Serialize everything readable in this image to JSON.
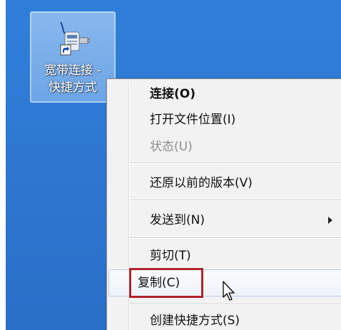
{
  "desktop": {
    "icon": {
      "name": "broadband-connection-shortcut",
      "label_line1": "宽带连接 -",
      "label_line2": "快捷方式"
    }
  },
  "context_menu": {
    "items": [
      {
        "id": "connect",
        "label": "连接(O)",
        "bold": true,
        "disabled": false
      },
      {
        "id": "open-location",
        "label": "打开文件位置(I)",
        "bold": false,
        "disabled": false
      },
      {
        "id": "status",
        "label": "状态(U)",
        "bold": false,
        "disabled": true
      },
      {
        "id": "restore-previous",
        "label": "还原以前的版本(V)",
        "bold": false,
        "disabled": false
      },
      {
        "id": "send-to",
        "label": "发送到(N)",
        "bold": false,
        "disabled": false,
        "submenu": true
      },
      {
        "id": "cut",
        "label": "剪切(T)",
        "bold": false,
        "disabled": false
      },
      {
        "id": "copy",
        "label": "复制(C)",
        "bold": false,
        "disabled": false,
        "hovered": true,
        "highlighted": true
      },
      {
        "id": "create-shortcut",
        "label": "创建快捷方式(S)",
        "bold": false,
        "disabled": false
      }
    ]
  },
  "colors": {
    "desktop_bg": "#2f7ad4",
    "highlight_border": "#b0242a",
    "menu_bg": "#f2f2f2"
  }
}
